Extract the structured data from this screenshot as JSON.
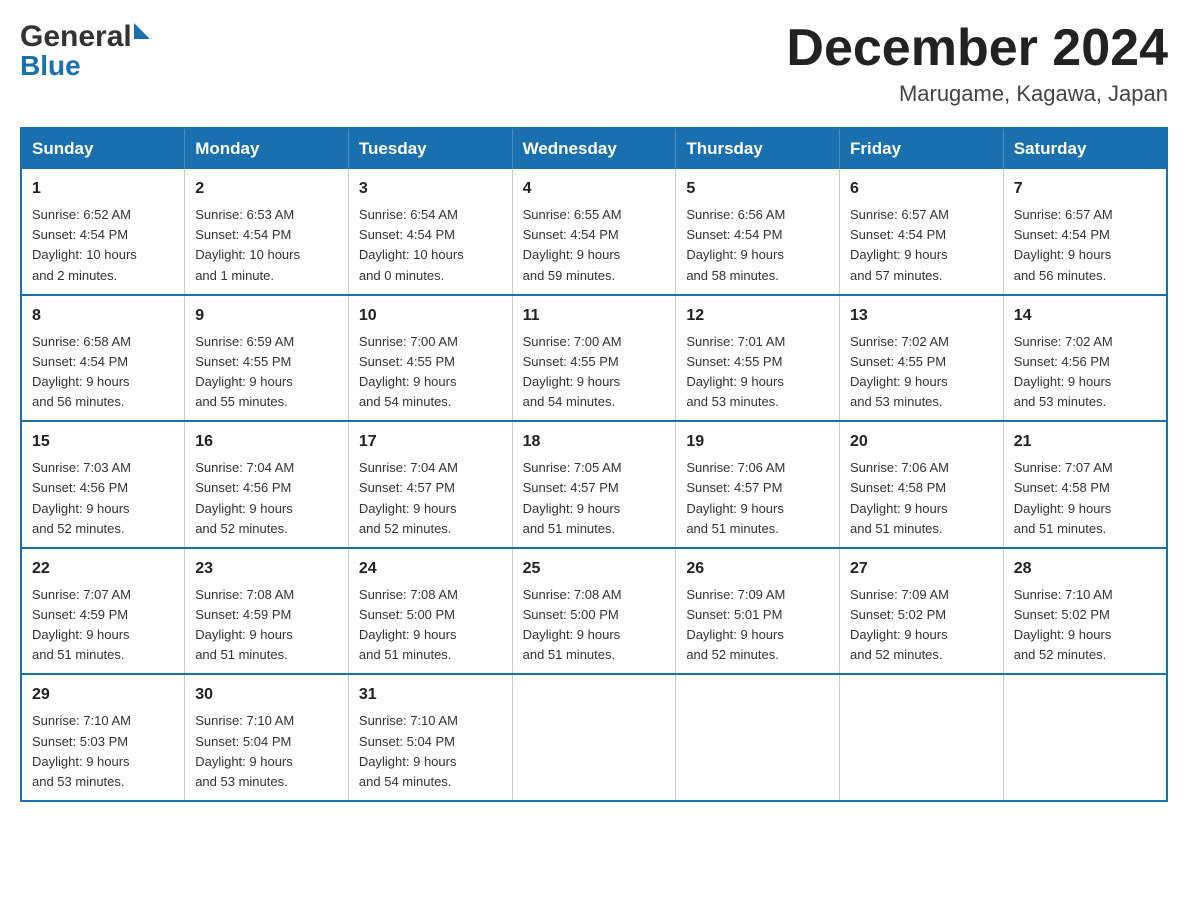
{
  "header": {
    "logo_general": "General",
    "logo_blue": "Blue",
    "month_year": "December 2024",
    "location": "Marugame, Kagawa, Japan"
  },
  "calendar": {
    "days_of_week": [
      "Sunday",
      "Monday",
      "Tuesday",
      "Wednesday",
      "Thursday",
      "Friday",
      "Saturday"
    ],
    "weeks": [
      [
        {
          "day": "1",
          "sunrise": "6:52 AM",
          "sunset": "4:54 PM",
          "daylight": "10 hours and 2 minutes."
        },
        {
          "day": "2",
          "sunrise": "6:53 AM",
          "sunset": "4:54 PM",
          "daylight": "10 hours and 1 minute."
        },
        {
          "day": "3",
          "sunrise": "6:54 AM",
          "sunset": "4:54 PM",
          "daylight": "10 hours and 0 minutes."
        },
        {
          "day": "4",
          "sunrise": "6:55 AM",
          "sunset": "4:54 PM",
          "daylight": "9 hours and 59 minutes."
        },
        {
          "day": "5",
          "sunrise": "6:56 AM",
          "sunset": "4:54 PM",
          "daylight": "9 hours and 58 minutes."
        },
        {
          "day": "6",
          "sunrise": "6:57 AM",
          "sunset": "4:54 PM",
          "daylight": "9 hours and 57 minutes."
        },
        {
          "day": "7",
          "sunrise": "6:57 AM",
          "sunset": "4:54 PM",
          "daylight": "9 hours and 56 minutes."
        }
      ],
      [
        {
          "day": "8",
          "sunrise": "6:58 AM",
          "sunset": "4:54 PM",
          "daylight": "9 hours and 56 minutes."
        },
        {
          "day": "9",
          "sunrise": "6:59 AM",
          "sunset": "4:55 PM",
          "daylight": "9 hours and 55 minutes."
        },
        {
          "day": "10",
          "sunrise": "7:00 AM",
          "sunset": "4:55 PM",
          "daylight": "9 hours and 54 minutes."
        },
        {
          "day": "11",
          "sunrise": "7:00 AM",
          "sunset": "4:55 PM",
          "daylight": "9 hours and 54 minutes."
        },
        {
          "day": "12",
          "sunrise": "7:01 AM",
          "sunset": "4:55 PM",
          "daylight": "9 hours and 53 minutes."
        },
        {
          "day": "13",
          "sunrise": "7:02 AM",
          "sunset": "4:55 PM",
          "daylight": "9 hours and 53 minutes."
        },
        {
          "day": "14",
          "sunrise": "7:02 AM",
          "sunset": "4:56 PM",
          "daylight": "9 hours and 53 minutes."
        }
      ],
      [
        {
          "day": "15",
          "sunrise": "7:03 AM",
          "sunset": "4:56 PM",
          "daylight": "9 hours and 52 minutes."
        },
        {
          "day": "16",
          "sunrise": "7:04 AM",
          "sunset": "4:56 PM",
          "daylight": "9 hours and 52 minutes."
        },
        {
          "day": "17",
          "sunrise": "7:04 AM",
          "sunset": "4:57 PM",
          "daylight": "9 hours and 52 minutes."
        },
        {
          "day": "18",
          "sunrise": "7:05 AM",
          "sunset": "4:57 PM",
          "daylight": "9 hours and 51 minutes."
        },
        {
          "day": "19",
          "sunrise": "7:06 AM",
          "sunset": "4:57 PM",
          "daylight": "9 hours and 51 minutes."
        },
        {
          "day": "20",
          "sunrise": "7:06 AM",
          "sunset": "4:58 PM",
          "daylight": "9 hours and 51 minutes."
        },
        {
          "day": "21",
          "sunrise": "7:07 AM",
          "sunset": "4:58 PM",
          "daylight": "9 hours and 51 minutes."
        }
      ],
      [
        {
          "day": "22",
          "sunrise": "7:07 AM",
          "sunset": "4:59 PM",
          "daylight": "9 hours and 51 minutes."
        },
        {
          "day": "23",
          "sunrise": "7:08 AM",
          "sunset": "4:59 PM",
          "daylight": "9 hours and 51 minutes."
        },
        {
          "day": "24",
          "sunrise": "7:08 AM",
          "sunset": "5:00 PM",
          "daylight": "9 hours and 51 minutes."
        },
        {
          "day": "25",
          "sunrise": "7:08 AM",
          "sunset": "5:00 PM",
          "daylight": "9 hours and 51 minutes."
        },
        {
          "day": "26",
          "sunrise": "7:09 AM",
          "sunset": "5:01 PM",
          "daylight": "9 hours and 52 minutes."
        },
        {
          "day": "27",
          "sunrise": "7:09 AM",
          "sunset": "5:02 PM",
          "daylight": "9 hours and 52 minutes."
        },
        {
          "day": "28",
          "sunrise": "7:10 AM",
          "sunset": "5:02 PM",
          "daylight": "9 hours and 52 minutes."
        }
      ],
      [
        {
          "day": "29",
          "sunrise": "7:10 AM",
          "sunset": "5:03 PM",
          "daylight": "9 hours and 53 minutes."
        },
        {
          "day": "30",
          "sunrise": "7:10 AM",
          "sunset": "5:04 PM",
          "daylight": "9 hours and 53 minutes."
        },
        {
          "day": "31",
          "sunrise": "7:10 AM",
          "sunset": "5:04 PM",
          "daylight": "9 hours and 54 minutes."
        },
        null,
        null,
        null,
        null
      ]
    ],
    "labels": {
      "sunrise": "Sunrise:",
      "sunset": "Sunset:",
      "daylight": "Daylight:"
    }
  }
}
